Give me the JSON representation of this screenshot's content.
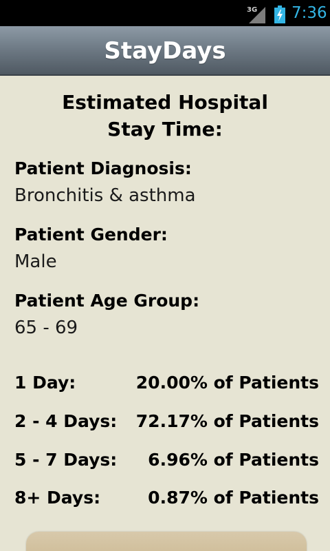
{
  "status_bar": {
    "network": "3G",
    "time": "7:36"
  },
  "app": {
    "title": "StayDays"
  },
  "heading": {
    "line1": "Estimated Hospital",
    "line2": "Stay Time:"
  },
  "patient": {
    "diagnosis_label": "Patient Diagnosis:",
    "diagnosis_value": "Bronchitis & asthma",
    "gender_label": "Patient Gender:",
    "gender_value": "Male",
    "age_label": "Patient Age Group:",
    "age_value": "65 - 69"
  },
  "stay_distribution": [
    {
      "label": "1 Day:",
      "value": "20.00% of Patients"
    },
    {
      "label": "2 - 4 Days:",
      "value": "72.17% of Patients"
    },
    {
      "label": "5 - 7 Days:",
      "value": "6.96% of Patients"
    },
    {
      "label": "8+ Days:",
      "value": "0.87% of Patients"
    }
  ],
  "colors": {
    "background": "#e6e4d3",
    "status_bar": "#000000",
    "clock": "#33b5e5",
    "title_bar": "#6f7b86",
    "button": "#cfbe9b"
  }
}
